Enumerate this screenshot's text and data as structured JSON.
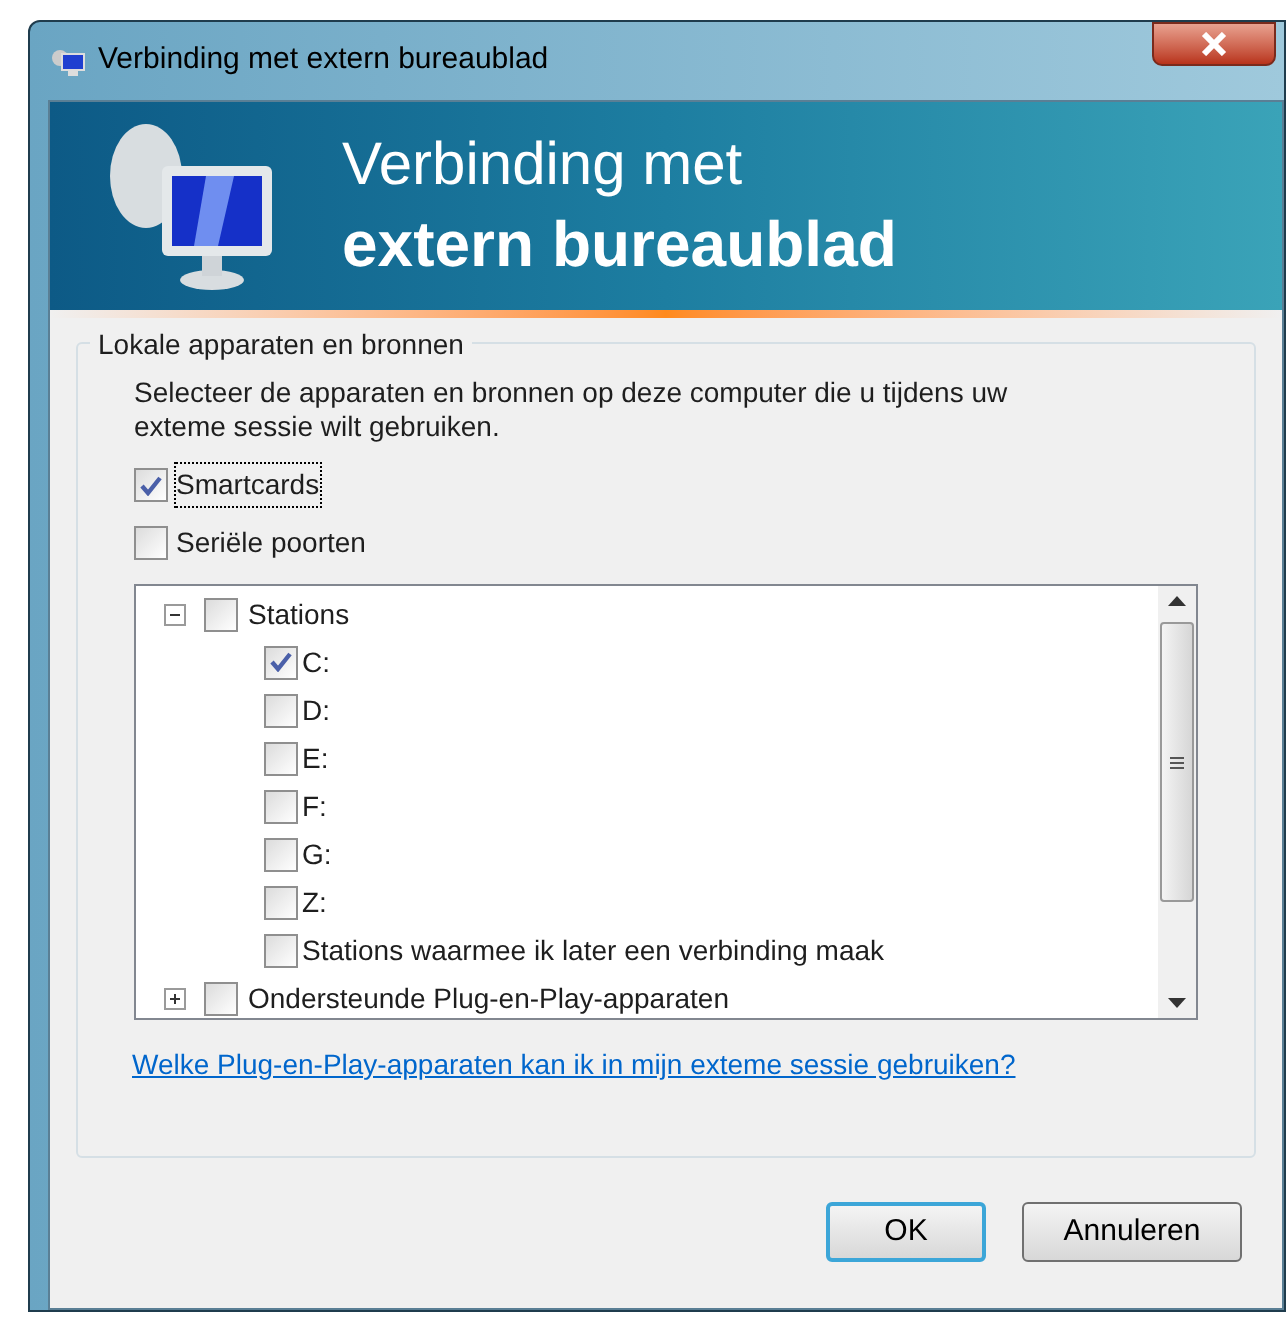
{
  "window": {
    "title": "Verbinding met extern bureaublad"
  },
  "banner": {
    "line_1": "Verbinding met",
    "line_2": "extern bureaublad"
  },
  "group": {
    "title": "Lokale apparaten en bronnen",
    "description": "Selecteer de apparaten en bronnen op deze computer die u tijdens uw exteme sessie wilt gebruiken.",
    "options": [
      {
        "label": "Smartcards",
        "checked": true,
        "focused": true
      },
      {
        "label": "Seriële poorten",
        "checked": false,
        "focused": false
      }
    ],
    "tree": [
      {
        "label": "Stations",
        "checked": false,
        "expanded": true,
        "children": [
          {
            "label": "C:",
            "checked": true
          },
          {
            "label": "D:",
            "checked": false
          },
          {
            "label": "E:",
            "checked": false
          },
          {
            "label": "F:",
            "checked": false
          },
          {
            "label": "G:",
            "checked": false
          },
          {
            "label": "Z:",
            "checked": false
          },
          {
            "label": "Stations waarmee ik later een verbinding maak",
            "checked": false
          }
        ]
      },
      {
        "label": "Ondersteunde Plug-en-Play-apparaten",
        "checked": false,
        "expanded": false
      }
    ],
    "link": "Welke Plug-en-Play-apparaten kan ik in mijn exteme sessie gebruiken?"
  },
  "buttons": [
    {
      "label": "OK",
      "default": true
    },
    {
      "label": "Annuleren",
      "default": false
    }
  ]
}
